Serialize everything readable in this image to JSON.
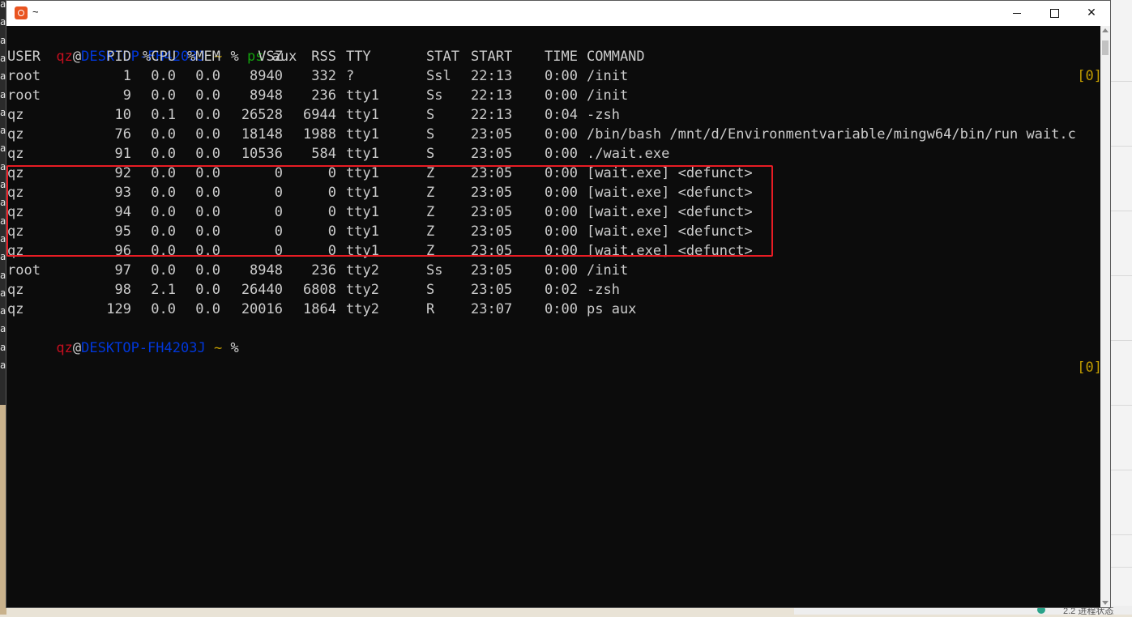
{
  "window": {
    "title": "~"
  },
  "background": {
    "left_glyph": "a",
    "bottom_text": "2.2 进程状态"
  },
  "prompt": {
    "user": "qz",
    "at": "@",
    "host": "DESKTOP-FH4203J",
    "dir": "~",
    "symbol": "%",
    "right": "[0]"
  },
  "command": {
    "name": "ps",
    "args": "aux"
  },
  "ps": {
    "headers": [
      "USER",
      "PID",
      "%CPU",
      "%MEM",
      "VSZ",
      "RSS",
      "TTY",
      "STAT",
      "START",
      "TIME",
      "COMMAND"
    ],
    "rows": [
      [
        "root",
        "1",
        "0.0",
        "0.0",
        "8940",
        "332",
        "?",
        "Ssl",
        "22:13",
        "0:00",
        "/init"
      ],
      [
        "root",
        "9",
        "0.0",
        "0.0",
        "8948",
        "236",
        "tty1",
        "Ss",
        "22:13",
        "0:00",
        "/init"
      ],
      [
        "qz",
        "10",
        "0.1",
        "0.0",
        "26528",
        "6944",
        "tty1",
        "S",
        "22:13",
        "0:04",
        "-zsh"
      ],
      [
        "qz",
        "76",
        "0.0",
        "0.0",
        "18148",
        "1988",
        "tty1",
        "S",
        "23:05",
        "0:00",
        "/bin/bash /mnt/d/Environmentvariable/mingw64/bin/run wait.c"
      ],
      [
        "qz",
        "91",
        "0.0",
        "0.0",
        "10536",
        "584",
        "tty1",
        "S",
        "23:05",
        "0:00",
        "./wait.exe"
      ],
      [
        "qz",
        "92",
        "0.0",
        "0.0",
        "0",
        "0",
        "tty1",
        "Z",
        "23:05",
        "0:00",
        "[wait.exe] <defunct>"
      ],
      [
        "qz",
        "93",
        "0.0",
        "0.0",
        "0",
        "0",
        "tty1",
        "Z",
        "23:05",
        "0:00",
        "[wait.exe] <defunct>"
      ],
      [
        "qz",
        "94",
        "0.0",
        "0.0",
        "0",
        "0",
        "tty1",
        "Z",
        "23:05",
        "0:00",
        "[wait.exe] <defunct>"
      ],
      [
        "qz",
        "95",
        "0.0",
        "0.0",
        "0",
        "0",
        "tty1",
        "Z",
        "23:05",
        "0:00",
        "[wait.exe] <defunct>"
      ],
      [
        "qz",
        "96",
        "0.0",
        "0.0",
        "0",
        "0",
        "tty1",
        "Z",
        "23:05",
        "0:00",
        "[wait.exe] <defunct>"
      ],
      [
        "root",
        "97",
        "0.0",
        "0.0",
        "8948",
        "236",
        "tty2",
        "Ss",
        "23:05",
        "0:00",
        "/init"
      ],
      [
        "qz",
        "98",
        "2.1",
        "0.0",
        "26440",
        "6808",
        "tty2",
        "S",
        "23:05",
        "0:02",
        "-zsh"
      ],
      [
        "qz",
        "129",
        "0.0",
        "0.0",
        "20016",
        "1864",
        "tty2",
        "R",
        "23:07",
        "0:00",
        "ps aux"
      ]
    ]
  },
  "colors": {
    "terminal_bg": "#0c0c0c",
    "text": "#cccccc",
    "prompt_user": "#c50f1f",
    "prompt_host": "#0037da",
    "prompt_dir": "#c19c00",
    "command": "#13a10e",
    "highlight_box": "#e81c24"
  }
}
